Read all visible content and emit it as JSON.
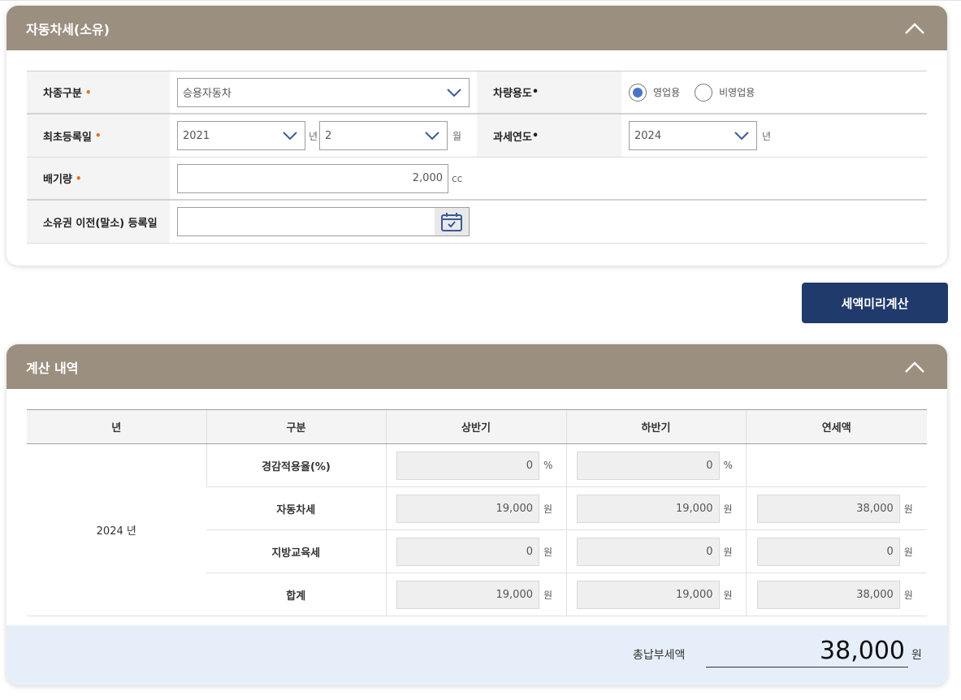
{
  "vehicle_panel": {
    "title": "자동차세(소유)",
    "vehicle_type": {
      "label": "차종구분",
      "req": "•",
      "value": "승용자동차"
    },
    "usage": {
      "label": "차량용도",
      "req": "•",
      "options": [
        "영업용",
        "비영업용"
      ],
      "selected": "영업용"
    },
    "first_reg": {
      "label": "최초등록일",
      "req": "•",
      "year": "2021",
      "year_unit": "년",
      "month": "2",
      "month_unit": "월"
    },
    "tax_year": {
      "label": "과세연도",
      "req": "•",
      "value": "2024",
      "unit": "년"
    },
    "displacement": {
      "label": "배기량",
      "req": "•",
      "value": "2,000",
      "unit": "cc"
    },
    "transfer_date": {
      "label": "소유권 이전(말소) 등록일",
      "value": ""
    }
  },
  "calc_button": "세액미리계산",
  "result_panel": {
    "title": "계산 내역",
    "headers": [
      "년",
      "구분",
      "상반기",
      "하반기",
      "연세액"
    ],
    "year_label": "2024 년",
    "rows": [
      {
        "category": "경감적용율(%)",
        "h1": "0",
        "h1_unit": "%",
        "h2": "0",
        "h2_unit": "%",
        "annual": "",
        "annual_unit": ""
      },
      {
        "category": "자동차세",
        "h1": "19,000",
        "h1_unit": "원",
        "h2": "19,000",
        "h2_unit": "원",
        "annual": "38,000",
        "annual_unit": "원"
      },
      {
        "category": "지방교육세",
        "h1": "0",
        "h1_unit": "원",
        "h2": "0",
        "h2_unit": "원",
        "annual": "0",
        "annual_unit": "원"
      },
      {
        "category": "합계",
        "h1": "19,000",
        "h1_unit": "원",
        "h2": "19,000",
        "h2_unit": "원",
        "annual": "38,000",
        "annual_unit": "원"
      }
    ],
    "total_label": "총납부세액",
    "total_value": "38,000",
    "total_unit": "원"
  },
  "colors": {
    "header_bg": "#9b8f7f",
    "button_bg": "#1f3a6b",
    "required_mark": "#e1701f",
    "radio_selected": "#4b74c9",
    "total_bg": "#e6eff9"
  },
  "icons": {
    "collapse": "chevron-up-icon",
    "dropdown": "chevron-down-icon",
    "calendar": "calendar-icon"
  }
}
